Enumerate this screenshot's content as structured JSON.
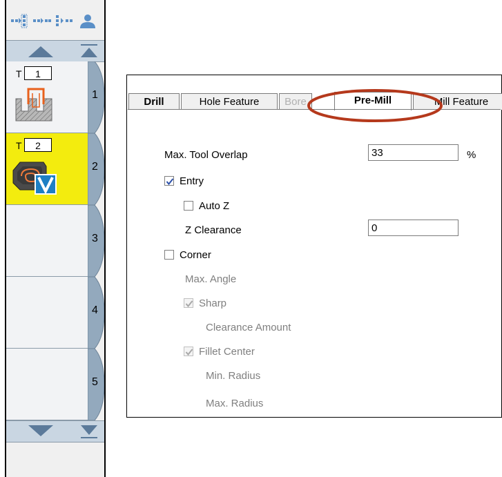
{
  "toolbar": {
    "icons": [
      "split-sequence-icon",
      "join-sequence-icon",
      "expand-sequence-icon",
      "user-icon"
    ]
  },
  "tool_list": {
    "scroll_up_label": "",
    "slots": [
      {
        "number": "1",
        "t_label": "T",
        "tool_number": "1",
        "icon": "pre-mill-operation-icon",
        "active": false
      },
      {
        "number": "2",
        "t_label": "T",
        "tool_number": "2",
        "icon": "vcarve-pocket-operation-icon",
        "active": true
      },
      {
        "number": "3",
        "t_label": "",
        "tool_number": "",
        "icon": "",
        "active": false
      },
      {
        "number": "4",
        "t_label": "",
        "tool_number": "",
        "icon": "",
        "active": false
      },
      {
        "number": "5",
        "t_label": "",
        "tool_number": "",
        "icon": "",
        "active": false
      }
    ]
  },
  "tabs": [
    {
      "label": "Drill",
      "bold": true,
      "enabled": true
    },
    {
      "label": "Hole Feature",
      "bold": false,
      "enabled": true
    },
    {
      "label": "Bore",
      "bold": false,
      "enabled": false
    },
    {
      "label": "Pre-Mill",
      "bold": true,
      "enabled": true,
      "active": true
    },
    {
      "label": "Mill Feature",
      "bold": false,
      "enabled": true
    }
  ],
  "form": {
    "max_tool_overlap_label": "Max. Tool Overlap",
    "max_tool_overlap_value": "33",
    "max_tool_overlap_unit": "%",
    "entry_label": "Entry",
    "entry_checked": true,
    "auto_z_label": "Auto Z",
    "auto_z_checked": false,
    "z_clearance_label": "Z Clearance",
    "z_clearance_value": "0",
    "corner_label": "Corner",
    "corner_checked": false,
    "max_angle_label": "Max. Angle",
    "sharp_label": "Sharp",
    "sharp_checked": true,
    "clearance_amount_label": "Clearance Amount",
    "fillet_center_label": "Fillet Center",
    "fillet_center_checked": true,
    "min_radius_label": "Min. Radius",
    "max_radius_label": "Max. Radius"
  },
  "colors": {
    "active_slot": "#f3ec0e",
    "highlight_ellipse": "#b5391c",
    "checkbox_mark": "#2b4fa8"
  }
}
